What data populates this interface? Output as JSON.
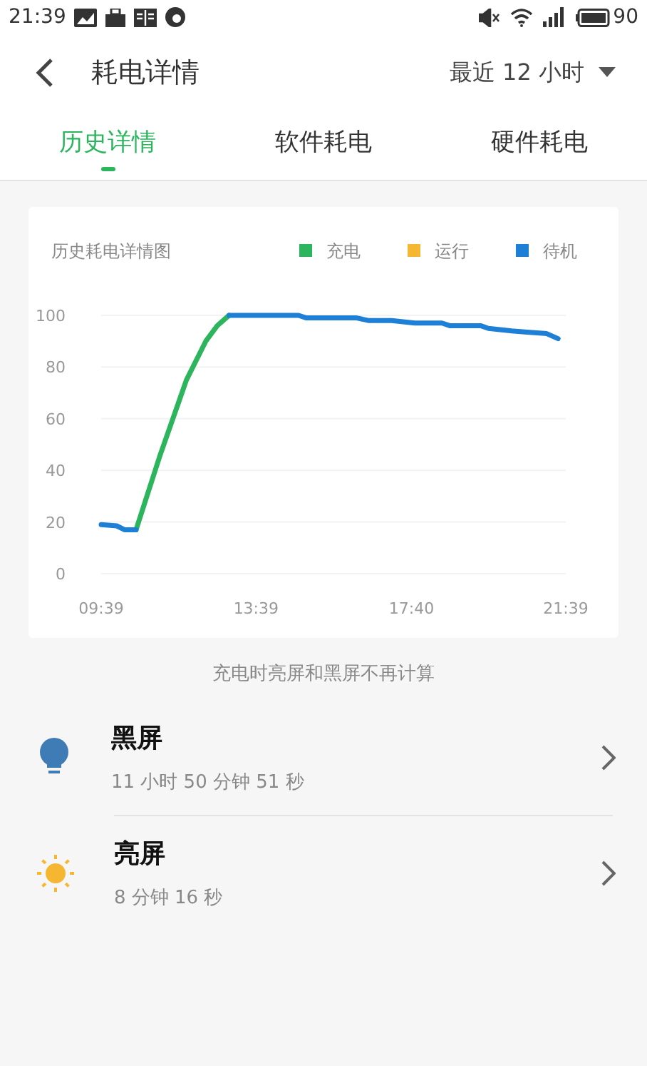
{
  "status_bar": {
    "time": "21:39",
    "battery": "90"
  },
  "header": {
    "title": "耗电详情",
    "range": "最近 12 小时"
  },
  "tabs": [
    {
      "label": "历史详情",
      "selected": true
    },
    {
      "label": "软件耗电",
      "selected": false
    },
    {
      "label": "硬件耗电",
      "selected": false
    }
  ],
  "chart": {
    "chart_data": {
      "type": "line",
      "title": "历史耗电详情图",
      "x": [
        579,
        603,
        615,
        633,
        669,
        711,
        741,
        759,
        777,
        885,
        897,
        975,
        993,
        1029,
        1065,
        1107,
        1119,
        1167,
        1179,
        1215,
        1239,
        1269,
        1287
      ],
      "series": [
        {
          "name": "充电",
          "color": "#2db55d",
          "values": [
            null,
            null,
            null,
            17,
            45,
            75,
            90,
            96,
            100,
            null,
            null,
            null,
            null,
            null,
            null,
            null,
            null,
            null,
            null,
            null,
            null,
            null,
            null
          ]
        },
        {
          "name": "运行",
          "color": "#f5b731",
          "values": [
            null,
            null,
            null,
            null,
            null,
            null,
            null,
            null,
            null,
            null,
            null,
            null,
            null,
            null,
            null,
            null,
            null,
            null,
            null,
            null,
            null,
            null,
            null
          ]
        },
        {
          "name": "待机",
          "color": "#1e7fd6",
          "values": [
            19,
            18.5,
            17,
            17,
            null,
            null,
            null,
            null,
            100,
            100,
            99,
            99,
            98,
            98,
            97,
            97,
            96,
            96,
            95,
            94,
            93.5,
            93,
            91
          ]
        }
      ],
      "xlim": [
        579,
        1299
      ],
      "ylim": [
        0,
        100
      ],
      "xticks": [
        {
          "value": 579,
          "label": "09:39"
        },
        {
          "value": 819,
          "label": "13:39"
        },
        {
          "value": 1060,
          "label": "17:40"
        },
        {
          "value": 1299,
          "label": "21:39"
        }
      ],
      "yticks": [
        0,
        20,
        40,
        60,
        80,
        100
      ],
      "grid": "y",
      "legend": "top-right"
    }
  },
  "note": "充电时亮屏和黑屏不再计算",
  "items": [
    {
      "kind": "bulb",
      "title": "黑屏",
      "detail": "11 小时 50 分钟 51 秒"
    },
    {
      "kind": "sun",
      "title": "亮屏",
      "detail": "8 分钟 16 秒"
    }
  ]
}
